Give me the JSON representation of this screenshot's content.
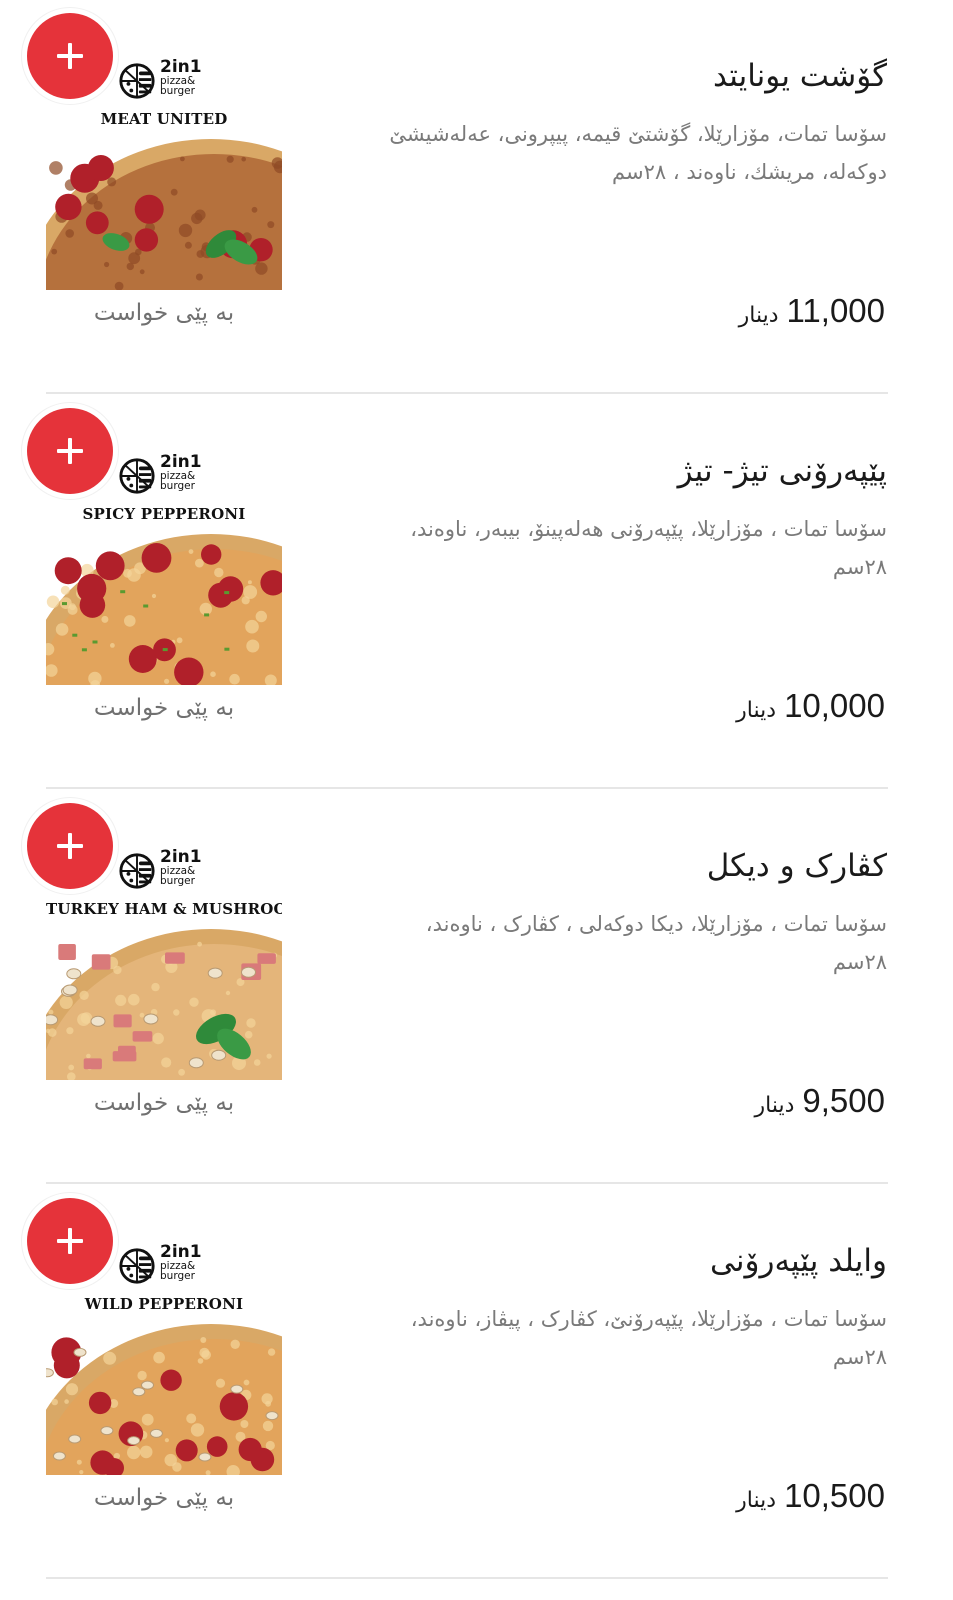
{
  "menu": {
    "items": [
      {
        "name": "گۆشت یونایتد",
        "description": "سۆسا تمات، مۆزارێلا، گۆشتێ قیمە، پیپرونی، عەلەشیشێ دوکەلە، مریشك، ناوەند ، ٢٨سم",
        "price_amount": "11,000",
        "price_currency": "دینار",
        "custom_note": "بە پێی خواست",
        "image_brand": "2in1",
        "image_brand_sub": "pizza&\nburger",
        "image_label": "MEAT UNITED",
        "image_style": "meat"
      },
      {
        "name": "پێپەرۆنی تیژ- تیژ",
        "description": "سۆسا تمات ، مۆزارێلا، پێپەرۆنی هەلەپینۆ، بیبەر، ناوەند، ٢٨سم",
        "price_amount": "10,000",
        "price_currency": "دینار",
        "custom_note": "بە پێی خواست",
        "image_brand": "2in1",
        "image_brand_sub": "pizza&\nburger",
        "image_label": "SPICY PEPPERONI",
        "image_style": "spicy"
      },
      {
        "name": "کڤارک و دیکل",
        "description": "سۆسا تمات ، مۆزارێلا، دیکا دوکەلی ، کڤارک ، ناوەند، ٢٨سم",
        "price_amount": "9,500",
        "price_currency": "دینار",
        "custom_note": "بە پێی خواست",
        "image_brand": "2in1",
        "image_brand_sub": "pizza&\nburger",
        "image_label": "TURKEY HAM & MUSHROOMS",
        "image_style": "ham"
      },
      {
        "name": "وایلد پێپەرۆنی",
        "description": "سۆسا تمات ، مۆزارێلا، پێپەرۆنێ، کڤارک ، پیڤاز، ناوەند، ٢٨سم",
        "price_amount": "10,500",
        "price_currency": "دینار",
        "custom_note": "بە پێی خواست",
        "image_brand": "2in1",
        "image_brand_sub": "pizza&\nburger",
        "image_label": "WILD PEPPERONI",
        "image_style": "wild"
      }
    ]
  },
  "colors": {
    "accent": "#e5333a",
    "divider": "#e6e6e6",
    "muted_text": "#7a7a7a"
  },
  "icons": {
    "add_button": "plus-icon",
    "brand_logo": "pizza-burger-logo"
  }
}
